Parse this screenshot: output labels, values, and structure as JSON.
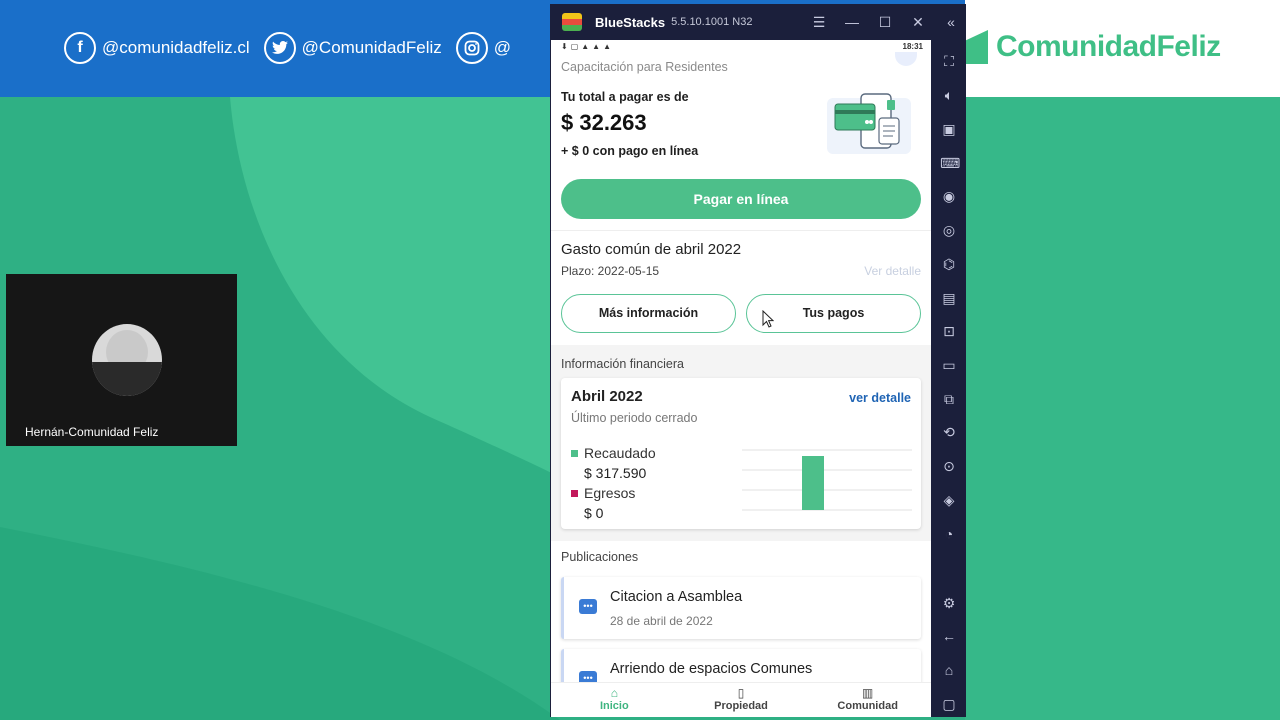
{
  "social": {
    "facebook": "@comunidadfeliz.cl",
    "twitter": "@ComunidadFeliz",
    "instagram_partial": "@"
  },
  "brand": {
    "name": "ComunidadFeliz"
  },
  "webcam": {
    "participant_name": "Hernán-Comunidad Feliz"
  },
  "bluestacks": {
    "title": "BlueStacks",
    "version": "5.5.10.1001 N32",
    "controls": [
      "menu-icon",
      "minimize-icon",
      "maximize-icon",
      "close-icon",
      "collapse-icon"
    ],
    "sidebar_icons": [
      "fullscreen-icon",
      "volume-icon",
      "media-icon",
      "keyboard-icon",
      "macro-icon",
      "sync-icon",
      "game-controls-icon",
      "apk-icon",
      "screenshot-icon",
      "folder-icon",
      "multi-instance-icon",
      "rotate-icon",
      "location-icon",
      "layers-icon",
      "eco-mode-icon",
      "settings-icon",
      "back-icon",
      "home-icon",
      "recent-apps-icon"
    ]
  },
  "phone": {
    "status_time": "18:31",
    "header_partial": "Capacitación para Residentes",
    "total": {
      "label": "Tu total a pagar es de",
      "amount": "$ 32.263",
      "extra": "+ $ 0 con pago en línea"
    },
    "pay_button": "Pagar en línea",
    "gasto": {
      "title": "Gasto común de abril 2022",
      "plazo": "Plazo: 2022-05-15",
      "ver_detalle": "Ver detalle"
    },
    "buttons": {
      "mas_info": "Más información",
      "tus_pagos": "Tus pagos"
    },
    "finance": {
      "header": "Información financiera",
      "period": "Abril 2022",
      "subtitle": "Último periodo cerrado",
      "link": "ver detalle",
      "recaudado_label": "Recaudado",
      "recaudado_value": "$ 317.590",
      "egresos_label": "Egresos",
      "egresos_value": "$ 0",
      "colors": {
        "recaudado": "#4dbf8a",
        "egresos": "#c2185b"
      }
    },
    "publicaciones": {
      "header": "Publicaciones",
      "items": [
        {
          "title": "Citacion a Asamblea",
          "date": "28 de abril de 2022"
        },
        {
          "title": "Arriendo de espacios Comunes",
          "date": ""
        }
      ]
    },
    "nav": [
      "Inicio",
      "Propiedad",
      "Comunidad"
    ]
  },
  "chart_data": {
    "type": "bar",
    "categories": [
      "Recaudado",
      "Egresos"
    ],
    "values": [
      317590,
      0
    ],
    "colors": [
      "#4dbf8a",
      "#c2185b"
    ],
    "grid": true
  }
}
